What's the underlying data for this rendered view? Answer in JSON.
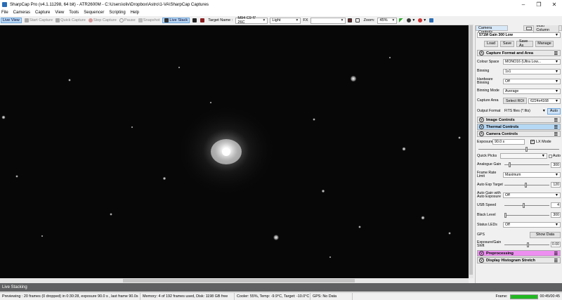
{
  "titlebar": {
    "title": "SharpCap Pro (v4.1.11298, 64 bit) - ATR2600M - C:\\Users\\oliv\\Dropbox\\Astro\\1-VA\\SharpCap Captures"
  },
  "menu": [
    "File",
    "Cameras",
    "Capture",
    "View",
    "Tools",
    "Sequencer",
    "Scripting",
    "Help"
  ],
  "toolbar": {
    "live_view": "Live View",
    "start_capture": "Start Capture",
    "quick_capture": "Quick Capture",
    "stop_capture": "Stop Capture",
    "pause": "Pause",
    "snapshot": "Snapshot",
    "live_stack": "Live Stack",
    "target_label": "Target Name :",
    "target_value": "M94 C9 f7 26C",
    "frame_type": "Light",
    "fx_label": "FX",
    "fx_value": "",
    "zoom_label": "Zoom:",
    "zoom_value": "45%"
  },
  "panel": {
    "tabs": [
      "Camera Controls",
      "Multi Column"
    ],
    "profile": "571M Gain 300 Low",
    "buttons": [
      "Load",
      "Save",
      "Save As",
      "Manage"
    ],
    "capture_format": {
      "title": "Capture Format and Area",
      "colour_space_label": "Colour Space",
      "colour_space": "MONO16 (Ultra Low...",
      "binning_label": "Binning",
      "binning": "1x1",
      "hw_binning_label": "Hardware Binning",
      "hw_binning": "Off",
      "binning_mode_label": "Binning Mode",
      "binning_mode": "Average",
      "capture_area_label": "Capture Area",
      "select_roi": "Select ROI",
      "capture_area": "6224x4168",
      "output_format_label": "Output Format",
      "output_format": "FITS files (*.fits)",
      "auto_label": "Auto"
    },
    "image_controls": "Image Controls",
    "thermal_controls": "Thermal Controls",
    "camera_controls": {
      "title": "Camera Controls",
      "exposure_label": "Exposure",
      "exposure": "90.0 s",
      "lx_mode": "LX Mode",
      "quick_picks": "Quick Picks",
      "auto": "Auto",
      "analogue_gain_label": "Analogue Gain",
      "analogue_gain": "300",
      "frame_rate_label": "Frame Rate Limit",
      "frame_rate": "Maximum",
      "auto_exp_target_label": "Auto Exp Target",
      "auto_exp_target": "120",
      "auto_gain_label": "Auto Gain with Auto Exposure",
      "auto_gain": "Off",
      "usb_speed_label": "USB Speed",
      "usb_speed": "4",
      "black_level_label": "Black Level",
      "black_level": "300",
      "status_leds_label": "Status LEDs",
      "status_leds": "Off",
      "gps_label": "GPS",
      "show_data": "Show Data",
      "exposure_gain_shift_label": "Exposure/Gain Shift",
      "exposure_gain_shift": "0.00"
    },
    "preprocessing": "Preprocessing",
    "display_histogram": "Display Histogram Stretch"
  },
  "stackbar": {
    "label": "Live Stacking"
  },
  "statusbar": {
    "preview": "Previewing : 20 frames (0 dropped) in 0:30:28, exposure 90.0 s , last frame 90.0s",
    "memory": "Memory: 4 of 192 frames used, Disk: 1198 GB free",
    "cooler": "Cooler: 55%, Temp: -9.9°C, Target: -10.0°C",
    "gps": "GPS: No Data",
    "frame_label": "Frame:",
    "frame_progress": 1.0,
    "timer": "00:45/00:45"
  },
  "colors": {
    "accent": "#2a6db5",
    "thermal": "#b5d8f5",
    "preprocessing": "#ec8ff0",
    "progress": "#22b922"
  }
}
